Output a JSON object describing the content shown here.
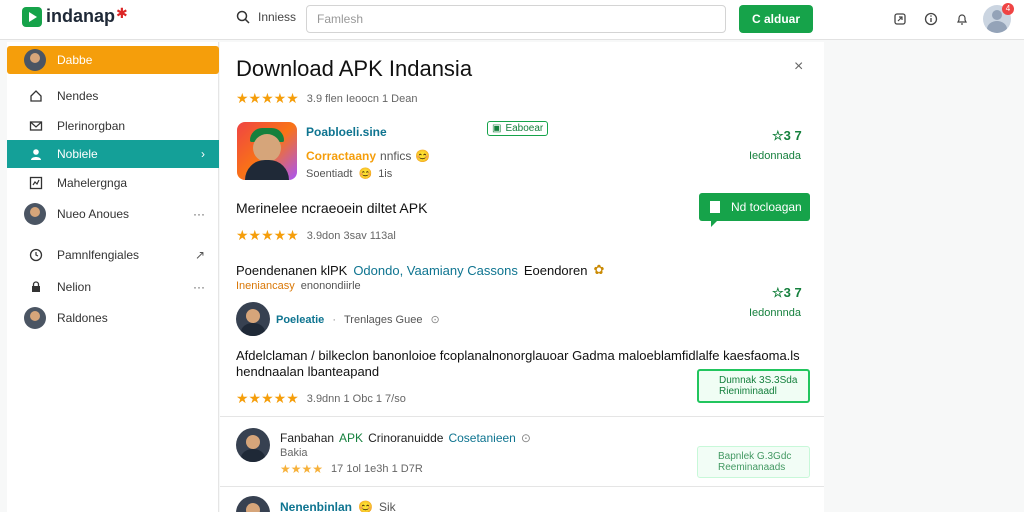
{
  "topbar": {
    "logo_text": "indanap",
    "logo_mark": "✱",
    "search_label": "Inniess",
    "search_placeholder": "Famlesh",
    "search_button": "C alduar",
    "notif_count": "4"
  },
  "sidebar": {
    "items": [
      {
        "label": "Dabbe",
        "icon": "avatar"
      },
      {
        "label": "Nendes",
        "icon": "home-icon"
      },
      {
        "label": "Plerinorgban",
        "icon": "mail-icon"
      },
      {
        "label": "Nobiele",
        "icon": "user-icon",
        "trail": "›"
      },
      {
        "label": "Mahelergnga",
        "icon": "chart-icon"
      },
      {
        "label": "Nueo Anoues",
        "icon": "avatar",
        "trail": "···"
      },
      {
        "label": "Pamnlfengiales",
        "icon": "clock-icon",
        "trail": "↗"
      },
      {
        "label": "Nelion",
        "icon": "lock-icon",
        "trail": "···"
      },
      {
        "label": "Raldones",
        "icon": "avatar"
      }
    ]
  },
  "main": {
    "title": "Download APK Indansia",
    "close": "×",
    "rating1": {
      "stars": "★★★★★",
      "meta": "3.9 flen   Ieoocn 1 Dean"
    },
    "app": {
      "name": "Poabloeli.sine",
      "dev": "Corractaany",
      "dev_suffix": "nnfics",
      "sub": "Soentiadt",
      "sub_suffix": "1is",
      "tag": "Eaboear",
      "score": "☆3 7",
      "score_label": "Iedonnada"
    },
    "section1": {
      "heading": "Merinelee ncraeoein diltet APK",
      "download": "Nd tocloagan",
      "stars": "★★★★★",
      "meta": "3.9don  3sav  113al"
    },
    "section2": {
      "line_start": "Poendenanen klPK",
      "line_link": "Odondo, Vaamiany Cassons",
      "line_end": "Eoendoren",
      "sub_link": "Ineniancasy",
      "sub_rest": "enonondiirle",
      "author": "Poeleatie",
      "author_rest": "Trenlages  Guee",
      "score": "☆3 7",
      "score_label": "Iedonnnda"
    },
    "section3": {
      "desc1": "Afdelclaman / bilkeclon banonloioe fcoplanalnonorglauoar Gadma maloeblamfidlalfe kaesfaoma.ls",
      "desc2": "hendnaalan lbanteapand",
      "stars": "★★★★★",
      "meta": "3.9dnn 1 Obc  1 7/so",
      "btn_line1": "Dumnak  3S.3Sda",
      "btn_line2": "Rieniminaadl"
    },
    "section4": {
      "title_start": "Fanbahan",
      "title_apk": "APK",
      "title_mid": "Crinoranuidde",
      "title_link": "Cosetanieen",
      "sub": "Bakia",
      "stars": "★★★★",
      "meta": "17  1ol 1e3h 1 D7R",
      "btn_line1": "Bapnlek  G.3Gdc",
      "btn_line2": "Reeminanaads"
    },
    "section5": {
      "title": "Nenenbinlan",
      "suffix": "Sik"
    }
  },
  "colors": {
    "accent": "#16a34a",
    "orange": "#f59e0b",
    "teal": "#14a098",
    "star": "#f59e0b"
  }
}
